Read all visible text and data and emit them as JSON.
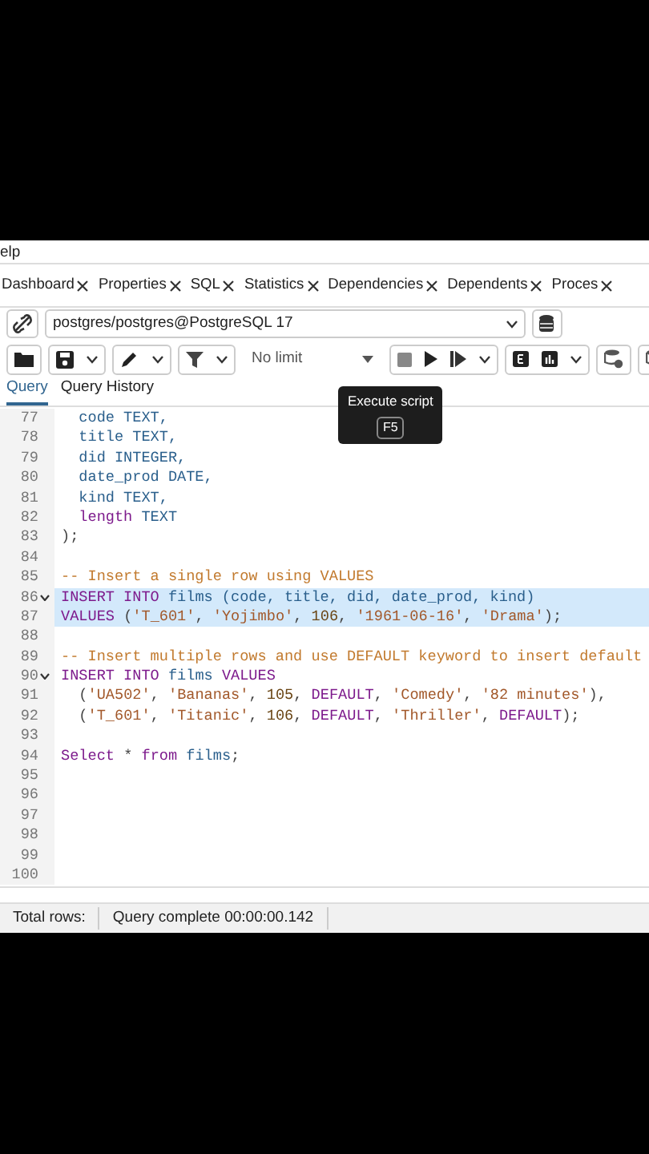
{
  "menu": {
    "partial_item": "elp"
  },
  "tabs": [
    {
      "label": "Dashboard",
      "selected": false
    },
    {
      "label": "Properties",
      "selected": false
    },
    {
      "label": "SQL",
      "selected": false
    },
    {
      "label": "Statistics",
      "selected": false
    },
    {
      "label": "Dependencies",
      "selected": false
    },
    {
      "label": "Dependents",
      "selected": false
    },
    {
      "label": "Proces",
      "selected": false
    }
  ],
  "connection": {
    "value": "postgres/postgres@PostgreSQL 17"
  },
  "toolbar": {
    "limit": "No limit"
  },
  "tooltip": {
    "text": "Execute script",
    "shortcut": "F5"
  },
  "query_tabs": [
    {
      "label": "Query",
      "selected": true
    },
    {
      "label": "Query History",
      "selected": false
    }
  ],
  "editor": {
    "lines": [
      {
        "number": "77",
        "fold": false,
        "highlighted": false,
        "tokens": [
          {
            "kind": "name",
            "text": "  code TEXT,"
          }
        ]
      },
      {
        "number": "78",
        "fold": false,
        "highlighted": false,
        "tokens": [
          {
            "kind": "name",
            "text": "  title TEXT,"
          }
        ]
      },
      {
        "number": "79",
        "fold": false,
        "highlighted": false,
        "tokens": [
          {
            "kind": "name",
            "text": "  did INTEGER,"
          }
        ]
      },
      {
        "number": "80",
        "fold": false,
        "highlighted": false,
        "tokens": [
          {
            "kind": "name",
            "text": "  date_prod DATE,"
          }
        ]
      },
      {
        "number": "81",
        "fold": false,
        "highlighted": false,
        "tokens": [
          {
            "kind": "name",
            "text": "  kind TEXT,"
          }
        ]
      },
      {
        "number": "82",
        "fold": false,
        "highlighted": false,
        "tokens": [
          {
            "kind": "keyword",
            "text": "  length"
          },
          {
            "kind": "name",
            "text": " TEXT"
          }
        ]
      },
      {
        "number": "83",
        "fold": false,
        "highlighted": false,
        "tokens": [
          {
            "kind": "plain",
            "text": ");"
          }
        ]
      },
      {
        "number": "84",
        "fold": false,
        "highlighted": false
      },
      {
        "number": "85",
        "fold": false,
        "highlighted": false,
        "tokens": [
          {
            "kind": "comment",
            "text": "-- Insert a single row using VALUES"
          }
        ]
      },
      {
        "number": "86",
        "fold": true,
        "highlighted": true,
        "tokens": [
          {
            "kind": "keyword",
            "text": "INSERT INTO"
          },
          {
            "kind": "name",
            "text": " films (code, title, did, date_prod, kind)"
          }
        ]
      },
      {
        "number": "87",
        "fold": false,
        "highlighted": true,
        "tokens": [
          {
            "kind": "keyword",
            "text": "VALUES"
          },
          {
            "kind": "plain",
            "text": " ("
          },
          {
            "kind": "string",
            "text": "'T_601'"
          },
          {
            "kind": "plain",
            "text": ", "
          },
          {
            "kind": "string",
            "text": "'Yojimbo'"
          },
          {
            "kind": "plain",
            "text": ", "
          },
          {
            "kind": "number",
            "text": "106"
          },
          {
            "kind": "plain",
            "text": ", "
          },
          {
            "kind": "string",
            "text": "'1961-06-16'"
          },
          {
            "kind": "plain",
            "text": ", "
          },
          {
            "kind": "string",
            "text": "'Drama'"
          },
          {
            "kind": "plain",
            "text": ");"
          }
        ]
      },
      {
        "number": "88",
        "fold": false,
        "highlighted": false
      },
      {
        "number": "89",
        "fold": false,
        "highlighted": false,
        "tokens": [
          {
            "kind": "comment",
            "text": "-- Insert multiple rows and use DEFAULT keyword to insert default"
          }
        ]
      },
      {
        "number": "90",
        "fold": true,
        "highlighted": false,
        "tokens": [
          {
            "kind": "keyword",
            "text": "INSERT INTO"
          },
          {
            "kind": "name",
            "text": " films "
          },
          {
            "kind": "keyword",
            "text": "VALUES"
          }
        ]
      },
      {
        "number": "91",
        "fold": false,
        "highlighted": false,
        "tokens": [
          {
            "kind": "plain",
            "text": "  ("
          },
          {
            "kind": "string",
            "text": "'UA502'"
          },
          {
            "kind": "plain",
            "text": ", "
          },
          {
            "kind": "string",
            "text": "'Bananas'"
          },
          {
            "kind": "plain",
            "text": ", "
          },
          {
            "kind": "number",
            "text": "105"
          },
          {
            "kind": "plain",
            "text": ", "
          },
          {
            "kind": "keyword",
            "text": "DEFAULT"
          },
          {
            "kind": "plain",
            "text": ", "
          },
          {
            "kind": "string",
            "text": "'Comedy'"
          },
          {
            "kind": "plain",
            "text": ", "
          },
          {
            "kind": "string",
            "text": "'82 minutes'"
          },
          {
            "kind": "plain",
            "text": "),"
          }
        ]
      },
      {
        "number": "92",
        "fold": false,
        "highlighted": false,
        "tokens": [
          {
            "kind": "plain",
            "text": "  ("
          },
          {
            "kind": "string",
            "text": "'T_601'"
          },
          {
            "kind": "plain",
            "text": ", "
          },
          {
            "kind": "string",
            "text": "'Titanic'"
          },
          {
            "kind": "plain",
            "text": ", "
          },
          {
            "kind": "number",
            "text": "106"
          },
          {
            "kind": "plain",
            "text": ", "
          },
          {
            "kind": "keyword",
            "text": "DEFAULT"
          },
          {
            "kind": "plain",
            "text": ", "
          },
          {
            "kind": "string",
            "text": "'Thriller'"
          },
          {
            "kind": "plain",
            "text": ", "
          },
          {
            "kind": "keyword",
            "text": "DEFAULT"
          },
          {
            "kind": "plain",
            "text": ");"
          }
        ]
      },
      {
        "number": "93",
        "fold": false,
        "highlighted": false
      },
      {
        "number": "94",
        "fold": false,
        "highlighted": false,
        "tokens": [
          {
            "kind": "keyword",
            "text": "Select"
          },
          {
            "kind": "plain",
            "text": " * "
          },
          {
            "kind": "keyword",
            "text": "from"
          },
          {
            "kind": "name",
            "text": " films"
          },
          {
            "kind": "plain",
            "text": ";"
          }
        ]
      },
      {
        "number": "95",
        "fold": false,
        "highlighted": false
      },
      {
        "number": "96",
        "fold": false,
        "highlighted": false
      },
      {
        "number": "97",
        "fold": false,
        "highlighted": false
      },
      {
        "number": "98",
        "fold": false,
        "highlighted": false
      },
      {
        "number": "99",
        "fold": false,
        "highlighted": false
      },
      {
        "number": "100",
        "fold": false,
        "highlighted": false
      }
    ]
  },
  "status_bar": {
    "total_rows": "Total rows:",
    "message": "Query complete 00:00:00.142"
  }
}
